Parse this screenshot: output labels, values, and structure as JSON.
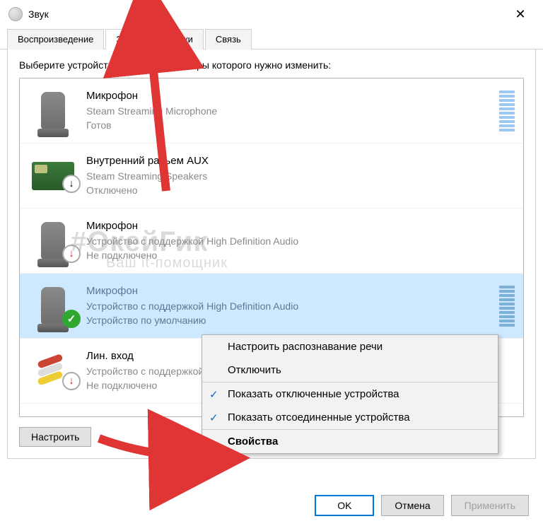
{
  "title": "Звук",
  "tabs": [
    {
      "label": "Воспроизведение"
    },
    {
      "label": "Запись"
    },
    {
      "label": "Звуки"
    },
    {
      "label": "Связь"
    }
  ],
  "active_tab": 1,
  "instructions": "Выберите устройство записи, параметры которого нужно изменить:",
  "devices": [
    {
      "name": "Микрофон",
      "desc": "Steam Streaming Microphone",
      "status": "Готов",
      "icon": "mic",
      "badge": null,
      "selected": false,
      "levels": true
    },
    {
      "name": "Внутренний разъем  AUX",
      "desc": "Steam Streaming Speakers",
      "status": "Отключено",
      "icon": "pcb",
      "badge": "down",
      "selected": false,
      "levels": false
    },
    {
      "name": "Микрофон",
      "desc": "Устройство с поддержкой High Definition Audio",
      "status": "Не подключено",
      "icon": "mic",
      "badge": "err",
      "selected": false,
      "levels": false
    },
    {
      "name": "Микрофон",
      "desc": "Устройство с поддержкой High Definition Audio",
      "status": "Устройство по умолчанию",
      "icon": "mic",
      "badge": "ok",
      "selected": true,
      "levels": true
    },
    {
      "name": "Лин. вход",
      "desc": "Устройство с поддержкой High Definition Audio",
      "status": "Не подключено",
      "icon": "linein",
      "badge": "err",
      "selected": false,
      "levels": false
    }
  ],
  "configure_label": "Настроить",
  "context_menu": [
    {
      "label": "Настроить распознавание речи",
      "checked": false,
      "bold": false,
      "sep": false
    },
    {
      "label": "Отключить",
      "checked": false,
      "bold": false,
      "sep": true
    },
    {
      "label": "Показать отключенные устройства",
      "checked": true,
      "bold": false,
      "sep": false
    },
    {
      "label": "Показать отсоединенные устройства",
      "checked": true,
      "bold": false,
      "sep": true
    },
    {
      "label": "Свойства",
      "checked": false,
      "bold": true,
      "sep": false
    }
  ],
  "buttons": {
    "ok": "OK",
    "cancel": "Отмена",
    "apply": "Применить"
  },
  "watermark": {
    "line1": "#ОкейГик",
    "line2": "Ваш it-помощник"
  }
}
